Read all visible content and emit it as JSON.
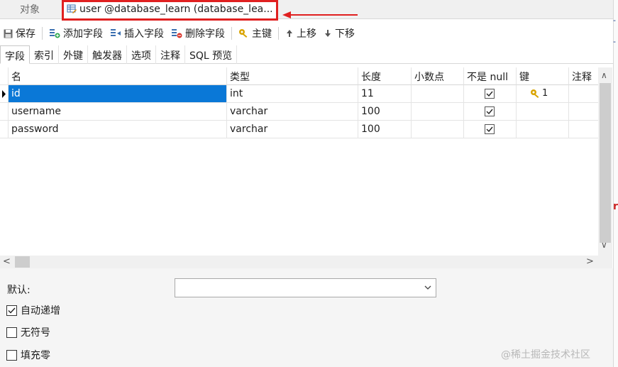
{
  "tabs": {
    "objects_label": "对象",
    "active_label": "user @database_learn (database_lea..."
  },
  "toolbar": {
    "save": "保存",
    "add_field": "添加字段",
    "insert_field": "插入字段",
    "delete_field": "删除字段",
    "primary_key": "主键",
    "move_up": "上移",
    "move_down": "下移"
  },
  "subtabs": [
    "字段",
    "索引",
    "外键",
    "触发器",
    "选项",
    "注释",
    "SQL 预览"
  ],
  "grid": {
    "headers": [
      "名",
      "类型",
      "长度",
      "小数点",
      "不是 null",
      "键",
      "注释"
    ],
    "rows": [
      {
        "name": "id",
        "type": "int",
        "length": "11",
        "decimal": "",
        "not_null": true,
        "key": "1"
      },
      {
        "name": "username",
        "type": "varchar",
        "length": "100",
        "decimal": "",
        "not_null": true,
        "key": ""
      },
      {
        "name": "password",
        "type": "varchar",
        "length": "100",
        "decimal": "",
        "not_null": true,
        "key": ""
      }
    ],
    "selected_row": 0
  },
  "props": {
    "default_label": "默认:",
    "default_value": "",
    "auto_increment_label": "自动递增",
    "auto_increment": true,
    "unsigned_label": "无符号",
    "unsigned": false,
    "zerofill_label": "填充零",
    "zerofill": false
  },
  "watermark": "@稀土掘金技术社区",
  "colors": {
    "highlight": "#e02020",
    "selection": "#0a78d7",
    "key_icon": "#d9a400"
  }
}
